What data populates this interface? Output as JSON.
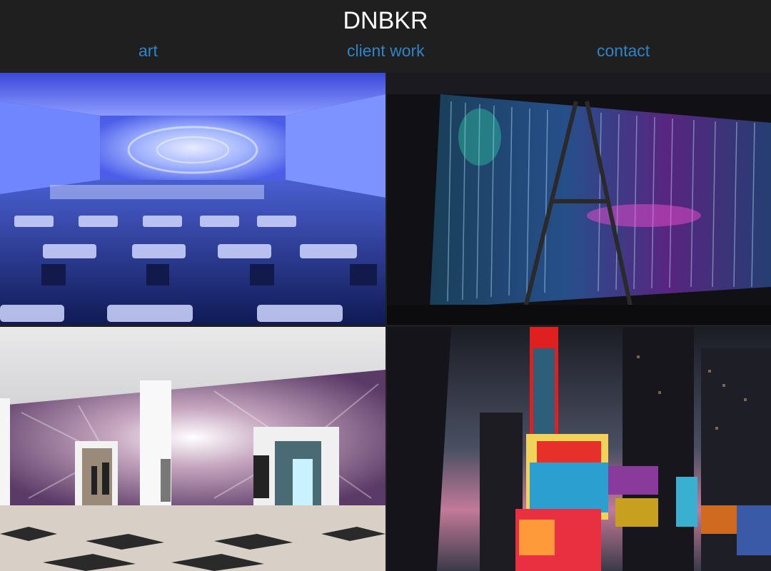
{
  "header": {
    "brand": "DNBKR",
    "nav": [
      {
        "label": "art"
      },
      {
        "label": "client work"
      },
      {
        "label": "contact"
      }
    ]
  },
  "colors": {
    "background": "#1f1f1f",
    "brand_text": "#ffffff",
    "nav_link": "#2f84c8"
  },
  "gallery": {
    "items": [
      {
        "id": "immersive-room",
        "icon": "photo-immersive-blue-room"
      },
      {
        "id": "light-curtain",
        "icon": "photo-fiber-light-curtain"
      },
      {
        "id": "lobby-wall",
        "icon": "photo-lobby-media-wall"
      },
      {
        "id": "times-square",
        "icon": "photo-times-square-billboards"
      }
    ]
  }
}
